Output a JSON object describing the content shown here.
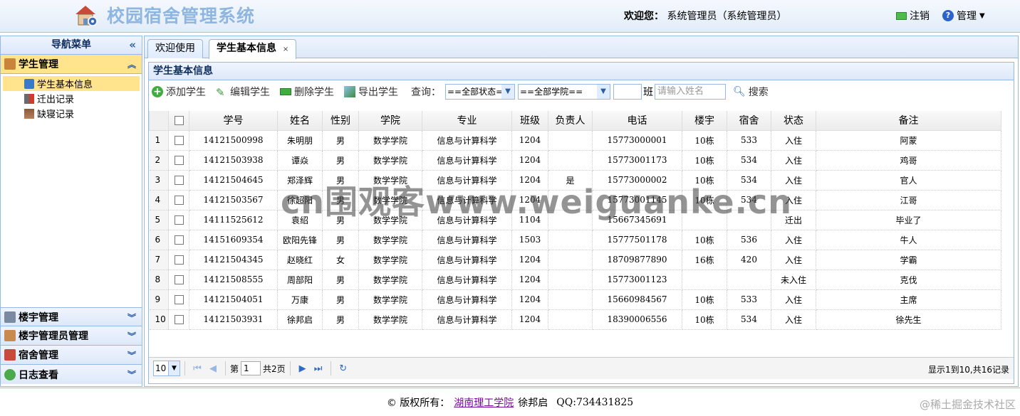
{
  "header": {
    "title": "校园宿舍管理系统",
    "welcome_label": "欢迎您：",
    "user": "系统管理员（系统管理员）",
    "logout_label": "注销",
    "manage_label": "管理",
    "logo_icon": "house-gear-icon"
  },
  "nav": {
    "title": "导航菜单",
    "panels": [
      {
        "label": "学生管理",
        "icon": "student-icon",
        "active": true
      },
      {
        "label": "楼宇管理",
        "icon": "building-icon"
      },
      {
        "label": "楼宇管理员管理",
        "icon": "admin-icon"
      },
      {
        "label": "宿舍管理",
        "icon": "house-icon"
      },
      {
        "label": "日志查看",
        "icon": "log-icon"
      }
    ],
    "items": [
      {
        "label": "学生基本信息",
        "icon": "info-icon",
        "selected": true
      },
      {
        "label": "迁出记录",
        "icon": "exit-icon"
      },
      {
        "label": "缺寝记录",
        "icon": "absence-icon"
      }
    ]
  },
  "tabs": [
    {
      "label": "欢迎使用"
    },
    {
      "label": "学生基本信息",
      "active": true
    }
  ],
  "panel": {
    "title": "学生基本信息"
  },
  "toolbar": {
    "add": "添加学生",
    "edit": "编辑学生",
    "delete": "删除学生",
    "export": "导出学生",
    "query": "查询：",
    "status_select": "==全部状态==",
    "college_select": "==全部学院==",
    "class_label": "班",
    "name_placeholder": "请输入姓名",
    "search": "搜索"
  },
  "table": {
    "columns": [
      "学号",
      "姓名",
      "性别",
      "学院",
      "专业",
      "班级",
      "负责人",
      "电话",
      "楼宇",
      "宿舍",
      "状态",
      "备注"
    ],
    "rows": [
      [
        "14121500998",
        "朱明朋",
        "男",
        "数学学院",
        "信息与计算科学",
        "1204",
        "",
        "15773000001",
        "10栋",
        "533",
        "入住",
        "阿蒙"
      ],
      [
        "14121503938",
        "谭焱",
        "男",
        "数学学院",
        "信息与计算科学",
        "1204",
        "",
        "15773001173",
        "10栋",
        "534",
        "入住",
        "鸡哥"
      ],
      [
        "14121504645",
        "郑泽辉",
        "男",
        "数学学院",
        "信息与计算科学",
        "1204",
        "是",
        "15773000002",
        "10栋",
        "534",
        "入住",
        "官人"
      ],
      [
        "14121503567",
        "徐超阳",
        "男",
        "数学学院",
        "信息与计算科学",
        "1204",
        "",
        "15773001145",
        "10栋",
        "534",
        "入住",
        "江哥"
      ],
      [
        "14111525612",
        "袁绍",
        "男",
        "数学学院",
        "信息与计算科学",
        "1104",
        "",
        "15667345691",
        "",
        "",
        "迁出",
        "毕业了"
      ],
      [
        "14151609354",
        "欧阳先锋",
        "男",
        "数学学院",
        "信息与计算科学",
        "1503",
        "",
        "15777501178",
        "10栋",
        "536",
        "入住",
        "牛人"
      ],
      [
        "14121504345",
        "赵晓红",
        "女",
        "数学学院",
        "信息与计算科学",
        "1204",
        "",
        "18709877890",
        "16栋",
        "420",
        "入住",
        "学霸"
      ],
      [
        "14121508555",
        "周部阳",
        "男",
        "数学学院",
        "信息与计算科学",
        "1204",
        "",
        "15773001123",
        "",
        "",
        "未入住",
        "克伐"
      ],
      [
        "14121504051",
        "万康",
        "男",
        "数学学院",
        "信息与计算科学",
        "1204",
        "",
        "15660984567",
        "10栋",
        "533",
        "入住",
        "主席"
      ],
      [
        "14121503931",
        "徐邦启",
        "男",
        "数学学院",
        "信息与计算科学",
        "1204",
        "",
        "18390006556",
        "10栋",
        "534",
        "入住",
        "徐先生"
      ]
    ]
  },
  "pager": {
    "page_size": "10",
    "page_prefix": "第",
    "page_value": "1",
    "page_suffix": "共2页",
    "info": "显示1到10,共16记录"
  },
  "footer": {
    "copyright": "© 版权所有：",
    "org": "湖南理工学院",
    "author": "徐邦启",
    "qq": "QQ:734431825"
  },
  "watermarks": {
    "overlay": "cn围观客www.weiguanke.cn",
    "corner": "@稀土掘金技术社区"
  }
}
